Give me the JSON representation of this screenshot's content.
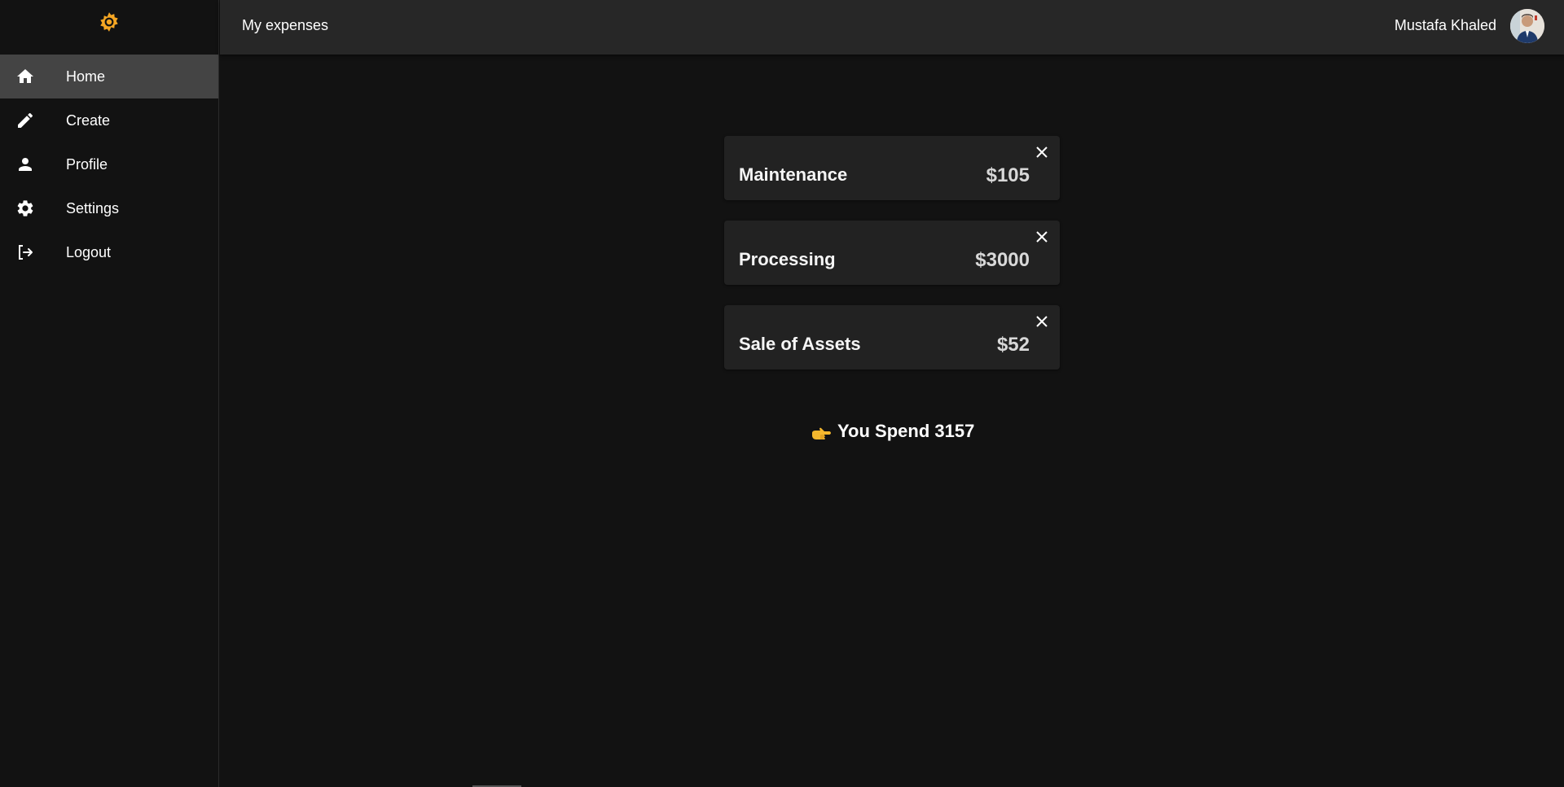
{
  "app": {
    "title": "My expenses",
    "accent_color": "#f5a623"
  },
  "sidebar": {
    "logo_icon": "sun-gear-icon",
    "items": [
      {
        "label": "Home",
        "icon": "home-icon",
        "active": true
      },
      {
        "label": "Create",
        "icon": "pencil-icon",
        "active": false
      },
      {
        "label": "Profile",
        "icon": "person-icon",
        "active": false
      },
      {
        "label": "Settings",
        "icon": "gear-icon",
        "active": false
      },
      {
        "label": "Logout",
        "icon": "logout-icon",
        "active": false
      }
    ]
  },
  "header": {
    "user_name": "Mustafa Khaled"
  },
  "expenses": [
    {
      "title": "Maintenance",
      "amount": "$105"
    },
    {
      "title": "Processing",
      "amount": "$3000"
    },
    {
      "title": "Sale of Assets",
      "amount": "$52"
    }
  ],
  "summary": {
    "text": "You Spend 3157",
    "icon": "pointing-hand-icon"
  }
}
